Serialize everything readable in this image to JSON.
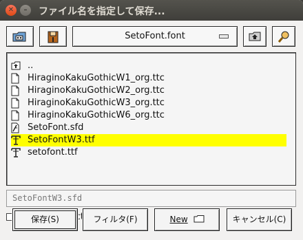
{
  "window": {
    "title": "ファイル名を指定して保存...",
    "close_glyph": "✕",
    "min_glyph": "–"
  },
  "toolbar": {
    "path": "SetoFont.font",
    "buttons": [
      "home-icon",
      "bookmarks-icon",
      "parent-dir-icon",
      "search-icon"
    ]
  },
  "files": [
    {
      "name": "..",
      "icon": "up-folder-icon"
    },
    {
      "name": "HiraginoKakuGothicW1_org.ttc",
      "icon": "file-icon"
    },
    {
      "name": "HiraginoKakuGothicW2_org.ttc",
      "icon": "file-icon"
    },
    {
      "name": "HiraginoKakuGothicW3_org.ttc",
      "icon": "file-icon"
    },
    {
      "name": "HiraginoKakuGothicW6_org.ttc",
      "icon": "file-icon"
    },
    {
      "name": "SetoFont.sfd",
      "icon": "sfd-file-icon"
    },
    {
      "name": "SetoFontW3.ttf",
      "icon": "font-file-icon",
      "selected": true
    },
    {
      "name": "setofont.ttf",
      "icon": "font-file-icon"
    }
  ],
  "filename_value": "SetoFontW3.sfd",
  "save_as_directory": {
    "label": "Save as Directory",
    "checked": false
  },
  "buttons": {
    "save": "保存(S)",
    "filter": "フィルタ(F)",
    "new": "New",
    "cancel": "キャンセル(C)"
  },
  "colors": {
    "selection": "#ffff00",
    "titlebar": "#3f3e3a",
    "close": "#df4a16"
  }
}
